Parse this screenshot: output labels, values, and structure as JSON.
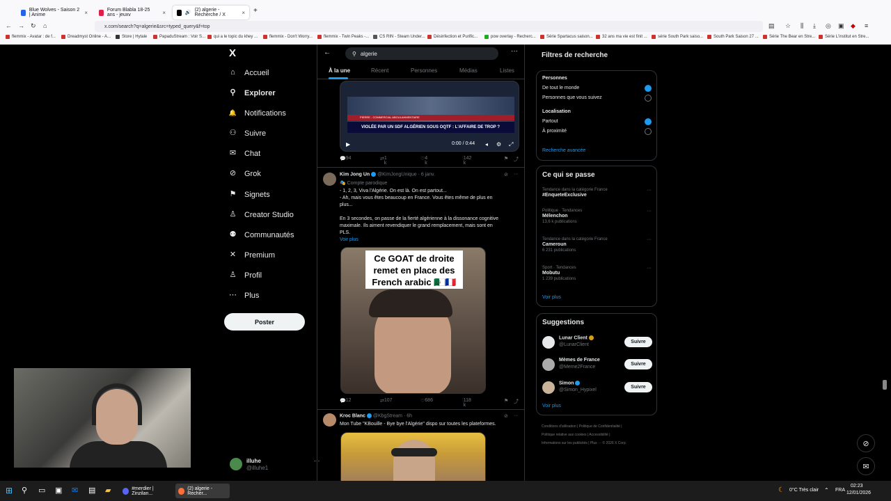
{
  "browser": {
    "tabs": [
      {
        "label": "Blue Wolves - Saison 2 | Anime",
        "color": "#2563eb"
      },
      {
        "label": "Forum Blabla 18-25 ans - jeuxv",
        "color": "#e11d48"
      },
      {
        "label": "(2) algerie - Recherche / X",
        "color": "#000000"
      }
    ],
    "url": "x.com/search?q=algerie&src=typed_query&f=top",
    "bookmarks": [
      "flemmix - Avatar : de f...",
      "Dreadmyst Online - A...",
      "Store | Hytale",
      "PapaduStream : Voir S...",
      "qui a le topic du khey ...",
      "flemmix - Don't Worry...",
      "flemmix - Twin Peaks -...",
      "CS RIN - Steam Under...",
      "Désinfection et Purific...",
      "pow overlay - Recherc...",
      "Série Spartacus saison...",
      "32 ans ma vie est finit ...",
      "série South Park saiso...",
      "South Park Saison 27 ...",
      "Série The Bear en Stre...",
      "Série L'institut en Stre..."
    ]
  },
  "nav": {
    "logo": "X",
    "items": [
      {
        "label": "Accueil",
        "icon": "home-icon",
        "glyph": "⌂"
      },
      {
        "label": "Explorer",
        "icon": "search-icon",
        "glyph": "⚲"
      },
      {
        "label": "Notifications",
        "icon": "bell-icon",
        "glyph": "🔔"
      },
      {
        "label": "Suivre",
        "icon": "add-user-icon",
        "glyph": "⚇"
      },
      {
        "label": "Chat",
        "icon": "chat-icon",
        "glyph": "✉"
      },
      {
        "label": "Grok",
        "icon": "grok-icon",
        "glyph": "⊘"
      },
      {
        "label": "Signets",
        "icon": "bookmark-icon",
        "glyph": "⚑"
      },
      {
        "label": "Creator Studio",
        "icon": "creator-icon",
        "glyph": "♙"
      },
      {
        "label": "Communautés",
        "icon": "communities-icon",
        "glyph": "⚉"
      },
      {
        "label": "Premium",
        "icon": "x-premium-icon",
        "glyph": "✕"
      },
      {
        "label": "Profil",
        "icon": "profile-icon",
        "glyph": "♙"
      },
      {
        "label": "Plus",
        "icon": "more-icon",
        "glyph": "⋯"
      }
    ],
    "post_button": "Poster",
    "account": {
      "name": "illuhe",
      "handle": "@illuhe1"
    }
  },
  "search": {
    "query": "algerie",
    "tabs": [
      "À la une",
      "Récent",
      "Personnes",
      "Médias",
      "Listes"
    ]
  },
  "tweet1": {
    "banner": "VIOLÉE PAR UN SDF ALGÉRIEN SOUS OQTF : L'AFFAIRE DE TROP ?",
    "ticker": "PIERRE - COMMERCIAL ABOULAHMENTAIRE",
    "time": "0:00 / 0:44",
    "stats": {
      "replies": "94",
      "retweets": "1 k",
      "likes": "4 k",
      "views": "142 k"
    }
  },
  "tweet2": {
    "name": "Kim Jong Un",
    "handle": "@KimJongUnique",
    "date": "6 janv.",
    "label": "Compte parodique",
    "text_lines": [
      "- 1, 2, 3, Viva l'Algérie. On est là. On est partout...",
      "- Ah, mais vous êtes beaucoup en France. Vous êtes même de plus en",
      "plus...",
      "",
      "En 3 secondes, on passe de la fierté algérienne à la dissonance cognitive",
      "maximale. Ils aiment revendiquer le grand remplacement, mais sont en",
      "PLS."
    ],
    "more": "Voir plus",
    "image_caption": [
      "Ce GOAT de droite",
      "remet en place des",
      "French arabic 🇩🇿🇫🇷"
    ],
    "stats": {
      "replies": "12",
      "retweets": "107",
      "likes": "686",
      "views": "118 k"
    }
  },
  "tweet3": {
    "name": "Kroc Blanc",
    "handle": "@KbgStream",
    "date": "6h",
    "text": "Mon Tube \"KBouille - Bye bye l'Algérie\" dispo sur toutes les plateformes."
  },
  "filters": {
    "title": "Filtres de recherche",
    "people_title": "Personnes",
    "people": [
      {
        "label": "De tout le monde",
        "on": true
      },
      {
        "label": "Personnes que vous suivez",
        "on": false
      }
    ],
    "location_title": "Localisation",
    "location": [
      {
        "label": "Partout",
        "on": true
      },
      {
        "label": "À proximité",
        "on": false
      }
    ],
    "advanced": "Recherche avancée"
  },
  "trends": {
    "title": "Ce qui se passe",
    "items": [
      {
        "context": "Tendance dans la catégorie France",
        "name": "#EnqueteExclusive",
        "count": ""
      },
      {
        "context": "Politique · Tendances",
        "name": "Mélenchon",
        "count": "13,6 k publications"
      },
      {
        "context": "Tendance dans la catégorie France",
        "name": "Cameroun",
        "count": "6 231 publications"
      },
      {
        "context": "Sport · Tendances",
        "name": "Mobutu",
        "count": "1 239 publications"
      }
    ],
    "more": "Voir plus"
  },
  "suggestions": {
    "title": "Suggestions",
    "items": [
      {
        "name": "Lunar Client",
        "handle": "@LunarClient",
        "button": "Suivre"
      },
      {
        "name": "Mèmes de France",
        "handle": "@Meme2France",
        "button": "Suivre"
      },
      {
        "name": "Simon",
        "handle": "@Simon_Hypixel",
        "button": "Suivre"
      }
    ],
    "more": "Voir plus"
  },
  "footer": [
    "Conditions d'utilisation",
    "Politique de Confidentialité",
    "Politique relative aux cookies",
    "Accessibilité",
    "Informations sur les publicités",
    "Plus ···",
    "© 2026 X Corp."
  ],
  "taskbar": {
    "apps": [
      "#merdier | Zinzilan...",
      "(2) algerie - Recher..."
    ],
    "weather": "0°C  Très clair",
    "lang": "FRA",
    "time": "02:23",
    "date": "12/01/2026"
  }
}
